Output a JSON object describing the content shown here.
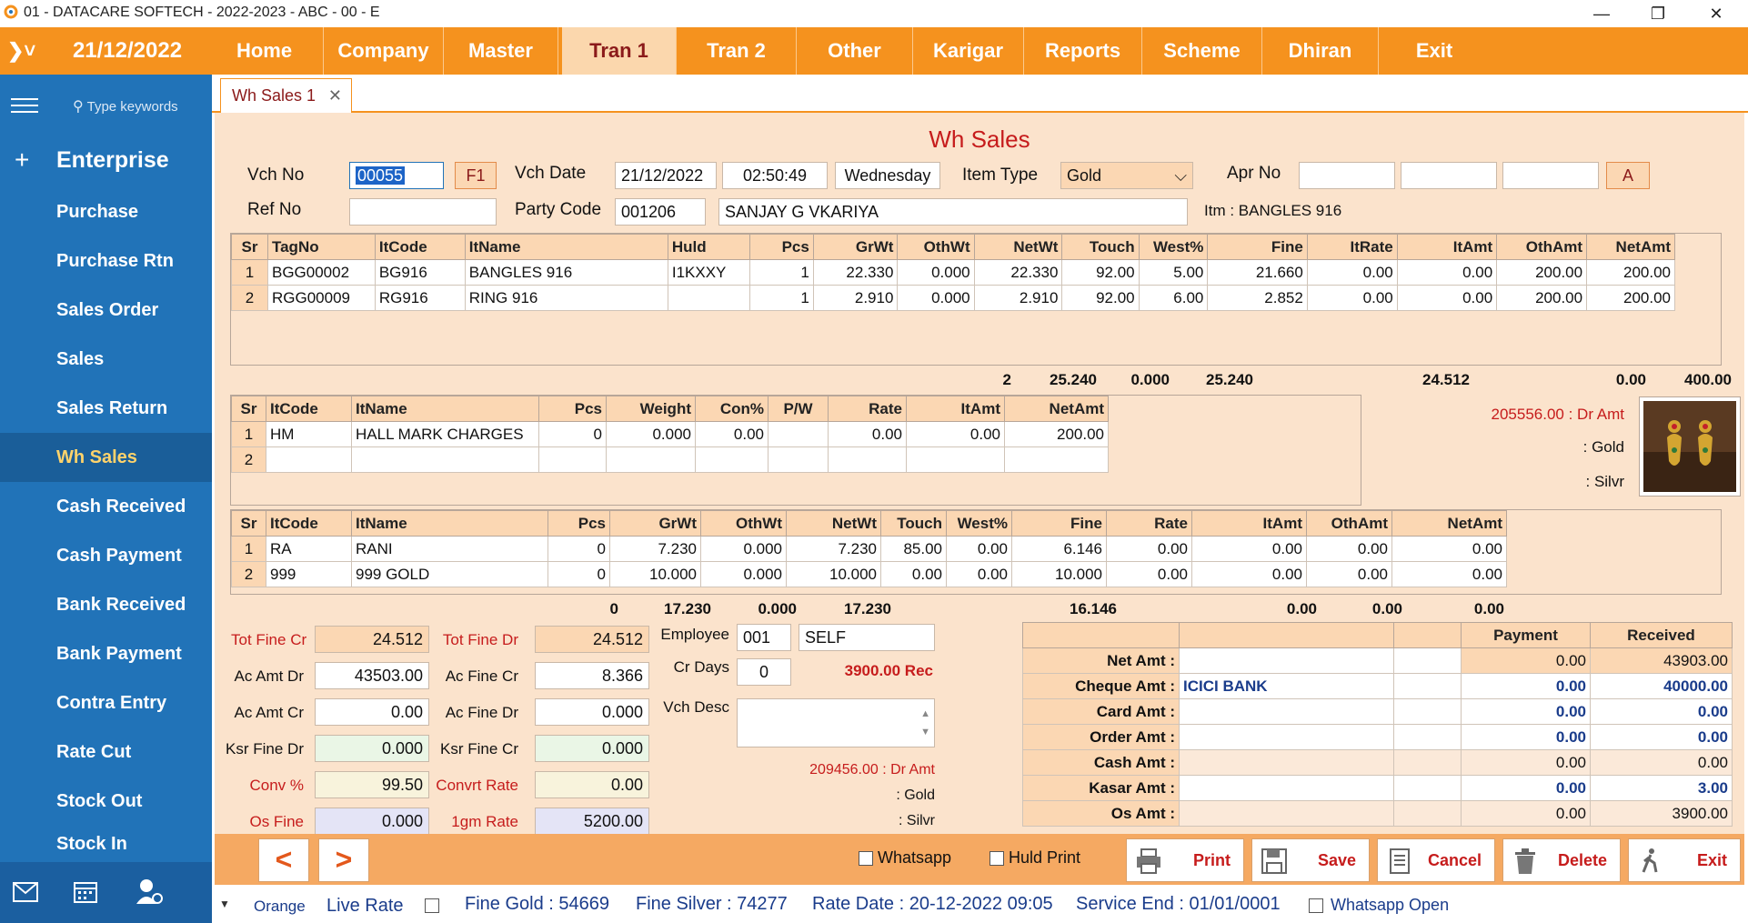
{
  "window": {
    "title": "01 - DATACARE SOFTECH - 2022-2023 - ABC - 00 - E",
    "minimize": "—",
    "maximize": "❐",
    "close": "✕"
  },
  "menubar": {
    "date": "21/12/2022",
    "items": [
      "Home",
      "Company",
      "Master",
      "Tran 1",
      "Tran 2",
      "Other",
      "Karigar",
      "Reports",
      "Scheme",
      "Dhiran",
      "Exit"
    ],
    "active": "Tran 1"
  },
  "sidebar": {
    "search_placeholder": "Type keywords",
    "section": "Enterprise",
    "items": [
      "Purchase",
      "Purchase Rtn",
      "Sales Order",
      "Sales",
      "Sales Return",
      "Wh Sales",
      "Cash Received",
      "Cash Payment",
      "Bank Received",
      "Bank Payment",
      "Contra Entry",
      "Rate Cut",
      "Stock Out",
      "Stock In"
    ],
    "active": "Wh Sales"
  },
  "tab": {
    "label": "Wh Sales 1",
    "close": "✕"
  },
  "form": {
    "title": "Wh Sales",
    "vch_no_label": "Vch No",
    "vch_no": "00055",
    "f1": "F1",
    "vch_date_label": "Vch Date",
    "vch_date": "21/12/2022",
    "time": "02:50:49",
    "day": "Wednesday",
    "item_type_label": "Item Type",
    "item_type": "Gold",
    "apr_no_label": "Apr No",
    "a_btn": "A",
    "ref_no_label": "Ref No",
    "ref_no": "",
    "party_code_label": "Party Code",
    "party_code": "001206",
    "party_name": "SANJAY G VKARIYA",
    "itm_info": "Itm : BANGLES 916"
  },
  "grid1": {
    "headers": [
      "Sr",
      "TagNo",
      "ItCode",
      "ItName",
      "Huld",
      "Pcs",
      "GrWt",
      "OthWt",
      "NetWt",
      "Touch",
      "West%",
      "Fine",
      "ItRate",
      "ItAmt",
      "OthAmt",
      "NetAmt"
    ],
    "rows": [
      [
        "1",
        "BGG00002",
        "BG916",
        "BANGLES 916",
        "I1KXXY",
        "1",
        "22.330",
        "0.000",
        "22.330",
        "92.00",
        "5.00",
        "21.660",
        "0.00",
        "0.00",
        "200.00",
        "200.00"
      ],
      [
        "2",
        "RGG00009",
        "RG916",
        "RING 916",
        "",
        "1",
        "2.910",
        "0.000",
        "2.910",
        "92.00",
        "6.00",
        "2.852",
        "0.00",
        "0.00",
        "200.00",
        "200.00"
      ]
    ],
    "totals": {
      "pcs": "2",
      "grwt": "25.240",
      "othwt": "0.000",
      "netwt": "25.240",
      "fine": "24.512",
      "itamt": "0.00",
      "othamt": "400.00",
      "netamt": "400.00"
    }
  },
  "grid2": {
    "headers": [
      "Sr",
      "ItCode",
      "ItName",
      "Pcs",
      "Weight",
      "Con%",
      "P/W",
      "Rate",
      "ItAmt",
      "NetAmt"
    ],
    "rows": [
      [
        "1",
        "HM",
        "HALL MARK CHARGES",
        "0",
        "0.000",
        "0.00",
        "",
        "0.00",
        "0.00",
        "200.00"
      ],
      [
        "2",
        "",
        "",
        "",
        "",
        "",
        "",
        "",
        "",
        ""
      ]
    ]
  },
  "side_info": {
    "dr_amt": "205556.00 : Dr Amt",
    "gold": ": Gold",
    "silver": ": Silvr"
  },
  "grid3": {
    "headers": [
      "Sr",
      "ItCode",
      "ItName",
      "Pcs",
      "GrWt",
      "OthWt",
      "NetWt",
      "Touch",
      "West%",
      "Fine",
      "Rate",
      "ItAmt",
      "OthAmt",
      "NetAmt"
    ],
    "rows": [
      [
        "1",
        "RA",
        "RANI",
        "0",
        "7.230",
        "0.000",
        "7.230",
        "85.00",
        "0.00",
        "6.146",
        "0.00",
        "0.00",
        "0.00",
        "0.00"
      ],
      [
        "2",
        "999",
        "999 GOLD",
        "0",
        "10.000",
        "0.000",
        "10.000",
        "0.00",
        "0.00",
        "10.000",
        "0.00",
        "0.00",
        "0.00",
        "0.00"
      ]
    ],
    "totals": {
      "pcs": "0",
      "grwt": "17.230",
      "othwt": "0.000",
      "netwt": "17.230",
      "fine": "16.146",
      "itamt": "0.00",
      "othamt": "0.00",
      "netamt": "0.00"
    }
  },
  "summary": {
    "tot_fine_cr_label": "Tot Fine Cr",
    "tot_fine_cr": "24.512",
    "tot_fine_dr_label": "Tot Fine Dr",
    "tot_fine_dr": "24.512",
    "ac_amt_dr_label": "Ac Amt Dr",
    "ac_amt_dr": "43503.00",
    "ac_fine_cr_label": "Ac Fine Cr",
    "ac_fine_cr": "8.366",
    "ac_amt_cr_label": "Ac Amt Cr",
    "ac_amt_cr": "0.00",
    "ac_fine_dr_label": "Ac Fine Dr",
    "ac_fine_dr": "0.000",
    "ksr_fine_dr_label": "Ksr Fine Dr",
    "ksr_fine_dr": "0.000",
    "ksr_fine_cr_label": "Ksr Fine Cr",
    "ksr_fine_cr": "0.000",
    "conv_label": "Conv %",
    "conv": "99.50",
    "convrt_rate_label": "Convrt Rate",
    "convrt_rate": "0.00",
    "os_fine_label": "Os Fine",
    "os_fine": "0.000",
    "gm_rate_label": "1gm Rate",
    "gm_rate": "5200.00",
    "employee_label": "Employee",
    "employee_code": "001",
    "employee_name": "SELF",
    "cr_days_label": "Cr Days",
    "cr_days": "0",
    "rec_amt": "3900.00 Rec",
    "vch_desc_label": "Vch Desc",
    "dr_amt2": "209456.00 : Dr Amt",
    "gold2": ": Gold",
    "silver2": ": Silvr"
  },
  "payment_table": {
    "headers": [
      "",
      "",
      "",
      "Payment",
      "Received"
    ],
    "rows": [
      {
        "label": "Net Amt :",
        "bank": "",
        "payment": "0.00",
        "received": "43903.00"
      },
      {
        "label": "Cheque Amt :",
        "bank": "ICICI BANK",
        "payment": "0.00",
        "received": "40000.00"
      },
      {
        "label": "Card Amt :",
        "bank": "",
        "payment": "0.00",
        "received": "0.00"
      },
      {
        "label": "Order Amt :",
        "bank": "",
        "payment": "0.00",
        "received": "0.00"
      },
      {
        "label": "Cash Amt :",
        "bank": "",
        "payment": "0.00",
        "received": "0.00"
      },
      {
        "label": "Kasar Amt :",
        "bank": "",
        "payment": "0.00",
        "received": "3.00"
      },
      {
        "label": "Os Amt :",
        "bank": "",
        "payment": "0.00",
        "received": "3900.00"
      }
    ]
  },
  "actions": {
    "prev": "<",
    "next": ">",
    "whatsapp": "Whatsapp",
    "huld_print": "Huld Print",
    "print": "Print",
    "save": "Save",
    "cancel": "Cancel",
    "delete": "Delete",
    "exit": "Exit"
  },
  "status": {
    "theme": "Orange",
    "live_rate": "Live Rate",
    "fine_gold": "Fine Gold : 54669",
    "fine_silver": "Fine Silver : 74277",
    "rate_date": "Rate Date : 20-12-2022 09:05",
    "service_end": "Service End :  01/01/0001",
    "whatsapp_open": "Whatsapp Open"
  },
  "colors": {
    "accent": "#f5921e",
    "sidebar": "#2173b8",
    "panel": "#fbe3cc",
    "header_cell": "#fbd7b3",
    "red_text": "#c61c1c"
  }
}
